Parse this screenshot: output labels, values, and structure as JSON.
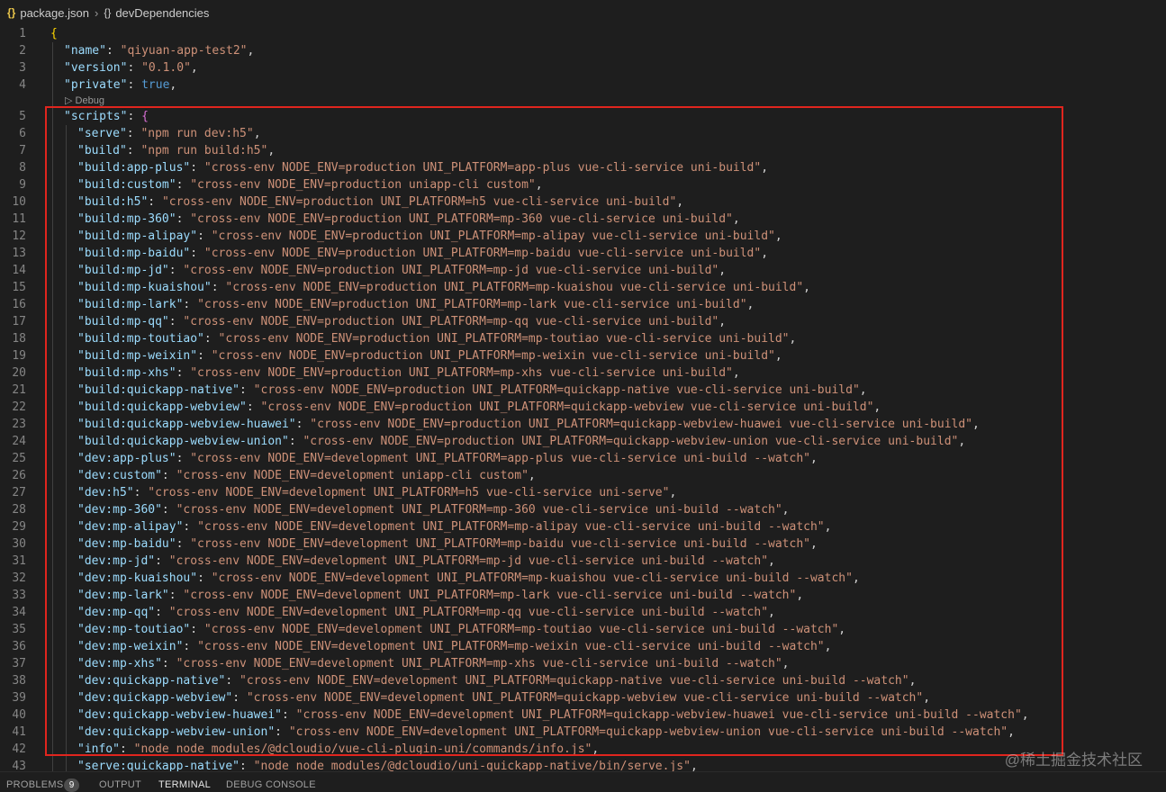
{
  "breadcrumb": {
    "file_icon": "{}",
    "file": "package.json",
    "separator_icon": "chevron-right-icon",
    "symbol_icon": "{}",
    "symbol": "devDependencies"
  },
  "codelens": {
    "label": "▷ Debug"
  },
  "editor": {
    "lines": [
      {
        "n": "1",
        "ind": 0,
        "kind": "open",
        "text": "{"
      },
      {
        "n": "2",
        "ind": 1,
        "kind": "kv",
        "key": "\"name\"",
        "val": "\"qiyuan-app-test2\"",
        "vtype": "str",
        "tail": ","
      },
      {
        "n": "3",
        "ind": 1,
        "kind": "kv",
        "key": "\"version\"",
        "val": "\"0.1.0\"",
        "vtype": "str",
        "tail": ","
      },
      {
        "n": "4",
        "ind": 1,
        "kind": "kv",
        "key": "\"private\"",
        "val": "true",
        "vtype": "bool",
        "tail": ","
      },
      {
        "n": "5",
        "ind": 1,
        "kind": "kobj",
        "key": "\"scripts\"",
        "val": "{",
        "vtype": "brace2",
        "tail": ""
      },
      {
        "n": "6",
        "ind": 2,
        "kind": "kv",
        "key": "\"serve\"",
        "val": "\"npm run dev:h5\"",
        "vtype": "str",
        "tail": ","
      },
      {
        "n": "7",
        "ind": 2,
        "kind": "kv",
        "key": "\"build\"",
        "val": "\"npm run build:h5\"",
        "vtype": "str",
        "tail": ","
      },
      {
        "n": "8",
        "ind": 2,
        "kind": "kv",
        "key": "\"build:app-plus\"",
        "val": "\"cross-env NODE_ENV=production UNI_PLATFORM=app-plus vue-cli-service uni-build\"",
        "vtype": "str",
        "tail": ","
      },
      {
        "n": "9",
        "ind": 2,
        "kind": "kv",
        "key": "\"build:custom\"",
        "val": "\"cross-env NODE_ENV=production uniapp-cli custom\"",
        "vtype": "str",
        "tail": ","
      },
      {
        "n": "10",
        "ind": 2,
        "kind": "kv",
        "key": "\"build:h5\"",
        "val": "\"cross-env NODE_ENV=production UNI_PLATFORM=h5 vue-cli-service uni-build\"",
        "vtype": "str",
        "tail": ","
      },
      {
        "n": "11",
        "ind": 2,
        "kind": "kv",
        "key": "\"build:mp-360\"",
        "val": "\"cross-env NODE_ENV=production UNI_PLATFORM=mp-360 vue-cli-service uni-build\"",
        "vtype": "str",
        "tail": ","
      },
      {
        "n": "12",
        "ind": 2,
        "kind": "kv",
        "key": "\"build:mp-alipay\"",
        "val": "\"cross-env NODE_ENV=production UNI_PLATFORM=mp-alipay vue-cli-service uni-build\"",
        "vtype": "str",
        "tail": ","
      },
      {
        "n": "13",
        "ind": 2,
        "kind": "kv",
        "key": "\"build:mp-baidu\"",
        "val": "\"cross-env NODE_ENV=production UNI_PLATFORM=mp-baidu vue-cli-service uni-build\"",
        "vtype": "str",
        "tail": ","
      },
      {
        "n": "14",
        "ind": 2,
        "kind": "kv",
        "key": "\"build:mp-jd\"",
        "val": "\"cross-env NODE_ENV=production UNI_PLATFORM=mp-jd vue-cli-service uni-build\"",
        "vtype": "str",
        "tail": ","
      },
      {
        "n": "15",
        "ind": 2,
        "kind": "kv",
        "key": "\"build:mp-kuaishou\"",
        "val": "\"cross-env NODE_ENV=production UNI_PLATFORM=mp-kuaishou vue-cli-service uni-build\"",
        "vtype": "str",
        "tail": ","
      },
      {
        "n": "16",
        "ind": 2,
        "kind": "kv",
        "key": "\"build:mp-lark\"",
        "val": "\"cross-env NODE_ENV=production UNI_PLATFORM=mp-lark vue-cli-service uni-build\"",
        "vtype": "str",
        "tail": ","
      },
      {
        "n": "17",
        "ind": 2,
        "kind": "kv",
        "key": "\"build:mp-qq\"",
        "val": "\"cross-env NODE_ENV=production UNI_PLATFORM=mp-qq vue-cli-service uni-build\"",
        "vtype": "str",
        "tail": ","
      },
      {
        "n": "18",
        "ind": 2,
        "kind": "kv",
        "key": "\"build:mp-toutiao\"",
        "val": "\"cross-env NODE_ENV=production UNI_PLATFORM=mp-toutiao vue-cli-service uni-build\"",
        "vtype": "str",
        "tail": ","
      },
      {
        "n": "19",
        "ind": 2,
        "kind": "kv",
        "key": "\"build:mp-weixin\"",
        "val": "\"cross-env NODE_ENV=production UNI_PLATFORM=mp-weixin vue-cli-service uni-build\"",
        "vtype": "str",
        "tail": ","
      },
      {
        "n": "20",
        "ind": 2,
        "kind": "kv",
        "key": "\"build:mp-xhs\"",
        "val": "\"cross-env NODE_ENV=production UNI_PLATFORM=mp-xhs vue-cli-service uni-build\"",
        "vtype": "str",
        "tail": ","
      },
      {
        "n": "21",
        "ind": 2,
        "kind": "kv",
        "key": "\"build:quickapp-native\"",
        "val": "\"cross-env NODE_ENV=production UNI_PLATFORM=quickapp-native vue-cli-service uni-build\"",
        "vtype": "str",
        "tail": ","
      },
      {
        "n": "22",
        "ind": 2,
        "kind": "kv",
        "key": "\"build:quickapp-webview\"",
        "val": "\"cross-env NODE_ENV=production UNI_PLATFORM=quickapp-webview vue-cli-service uni-build\"",
        "vtype": "str",
        "tail": ","
      },
      {
        "n": "23",
        "ind": 2,
        "kind": "kv",
        "key": "\"build:quickapp-webview-huawei\"",
        "val": "\"cross-env NODE_ENV=production UNI_PLATFORM=quickapp-webview-huawei vue-cli-service uni-build\"",
        "vtype": "str",
        "tail": ","
      },
      {
        "n": "24",
        "ind": 2,
        "kind": "kv",
        "key": "\"build:quickapp-webview-union\"",
        "val": "\"cross-env NODE_ENV=production UNI_PLATFORM=quickapp-webview-union vue-cli-service uni-build\"",
        "vtype": "str",
        "tail": ","
      },
      {
        "n": "25",
        "ind": 2,
        "kind": "kv",
        "key": "\"dev:app-plus\"",
        "val": "\"cross-env NODE_ENV=development UNI_PLATFORM=app-plus vue-cli-service uni-build --watch\"",
        "vtype": "str",
        "tail": ","
      },
      {
        "n": "26",
        "ind": 2,
        "kind": "kv",
        "key": "\"dev:custom\"",
        "val": "\"cross-env NODE_ENV=development uniapp-cli custom\"",
        "vtype": "str",
        "tail": ","
      },
      {
        "n": "27",
        "ind": 2,
        "kind": "kv",
        "key": "\"dev:h5\"",
        "val": "\"cross-env NODE_ENV=development UNI_PLATFORM=h5 vue-cli-service uni-serve\"",
        "vtype": "str",
        "tail": ","
      },
      {
        "n": "28",
        "ind": 2,
        "kind": "kv",
        "key": "\"dev:mp-360\"",
        "val": "\"cross-env NODE_ENV=development UNI_PLATFORM=mp-360 vue-cli-service uni-build --watch\"",
        "vtype": "str",
        "tail": ","
      },
      {
        "n": "29",
        "ind": 2,
        "kind": "kv",
        "key": "\"dev:mp-alipay\"",
        "val": "\"cross-env NODE_ENV=development UNI_PLATFORM=mp-alipay vue-cli-service uni-build --watch\"",
        "vtype": "str",
        "tail": ","
      },
      {
        "n": "30",
        "ind": 2,
        "kind": "kv",
        "key": "\"dev:mp-baidu\"",
        "val": "\"cross-env NODE_ENV=development UNI_PLATFORM=mp-baidu vue-cli-service uni-build --watch\"",
        "vtype": "str",
        "tail": ","
      },
      {
        "n": "31",
        "ind": 2,
        "kind": "kv",
        "key": "\"dev:mp-jd\"",
        "val": "\"cross-env NODE_ENV=development UNI_PLATFORM=mp-jd vue-cli-service uni-build --watch\"",
        "vtype": "str",
        "tail": ","
      },
      {
        "n": "32",
        "ind": 2,
        "kind": "kv",
        "key": "\"dev:mp-kuaishou\"",
        "val": "\"cross-env NODE_ENV=development UNI_PLATFORM=mp-kuaishou vue-cli-service uni-build --watch\"",
        "vtype": "str",
        "tail": ","
      },
      {
        "n": "33",
        "ind": 2,
        "kind": "kv",
        "key": "\"dev:mp-lark\"",
        "val": "\"cross-env NODE_ENV=development UNI_PLATFORM=mp-lark vue-cli-service uni-build --watch\"",
        "vtype": "str",
        "tail": ","
      },
      {
        "n": "34",
        "ind": 2,
        "kind": "kv",
        "key": "\"dev:mp-qq\"",
        "val": "\"cross-env NODE_ENV=development UNI_PLATFORM=mp-qq vue-cli-service uni-build --watch\"",
        "vtype": "str",
        "tail": ","
      },
      {
        "n": "35",
        "ind": 2,
        "kind": "kv",
        "key": "\"dev:mp-toutiao\"",
        "val": "\"cross-env NODE_ENV=development UNI_PLATFORM=mp-toutiao vue-cli-service uni-build --watch\"",
        "vtype": "str",
        "tail": ","
      },
      {
        "n": "36",
        "ind": 2,
        "kind": "kv",
        "key": "\"dev:mp-weixin\"",
        "val": "\"cross-env NODE_ENV=development UNI_PLATFORM=mp-weixin vue-cli-service uni-build --watch\"",
        "vtype": "str",
        "tail": ","
      },
      {
        "n": "37",
        "ind": 2,
        "kind": "kv",
        "key": "\"dev:mp-xhs\"",
        "val": "\"cross-env NODE_ENV=development UNI_PLATFORM=mp-xhs vue-cli-service uni-build --watch\"",
        "vtype": "str",
        "tail": ","
      },
      {
        "n": "38",
        "ind": 2,
        "kind": "kv",
        "key": "\"dev:quickapp-native\"",
        "val": "\"cross-env NODE_ENV=development UNI_PLATFORM=quickapp-native vue-cli-service uni-build --watch\"",
        "vtype": "str",
        "tail": ","
      },
      {
        "n": "39",
        "ind": 2,
        "kind": "kv",
        "key": "\"dev:quickapp-webview\"",
        "val": "\"cross-env NODE_ENV=development UNI_PLATFORM=quickapp-webview vue-cli-service uni-build --watch\"",
        "vtype": "str",
        "tail": ","
      },
      {
        "n": "40",
        "ind": 2,
        "kind": "kv",
        "key": "\"dev:quickapp-webview-huawei\"",
        "val": "\"cross-env NODE_ENV=development UNI_PLATFORM=quickapp-webview-huawei vue-cli-service uni-build --watch\"",
        "vtype": "str",
        "tail": ","
      },
      {
        "n": "41",
        "ind": 2,
        "kind": "kv",
        "key": "\"dev:quickapp-webview-union\"",
        "val": "\"cross-env NODE_ENV=development UNI_PLATFORM=quickapp-webview-union vue-cli-service uni-build --watch\"",
        "vtype": "str",
        "tail": ","
      },
      {
        "n": "42",
        "ind": 2,
        "kind": "kv",
        "key": "\"info\"",
        "val": "\"node node_modules/@dcloudio/vue-cli-plugin-uni/commands/info.js\"",
        "vtype": "str",
        "tail": ","
      },
      {
        "n": "43",
        "ind": 2,
        "kind": "kv",
        "key": "\"serve:quickapp-native\"",
        "val": "\"node node_modules/@dcloudio/uni-quickapp-native/bin/serve.js\"",
        "vtype": "str",
        "tail": ","
      }
    ]
  },
  "panel": {
    "tabs": [
      "PROBLEMS",
      "OUTPUT",
      "TERMINAL",
      "DEBUG CONSOLE"
    ],
    "problems_count": "9",
    "active_tab": "TERMINAL"
  },
  "watermark": "@稀土掘金技术社区",
  "colors": {
    "background": "#1e1e1e",
    "key": "#9cdcfe",
    "string": "#ce9178",
    "boolean": "#569cd6",
    "highlight_box": "#e0251e"
  }
}
